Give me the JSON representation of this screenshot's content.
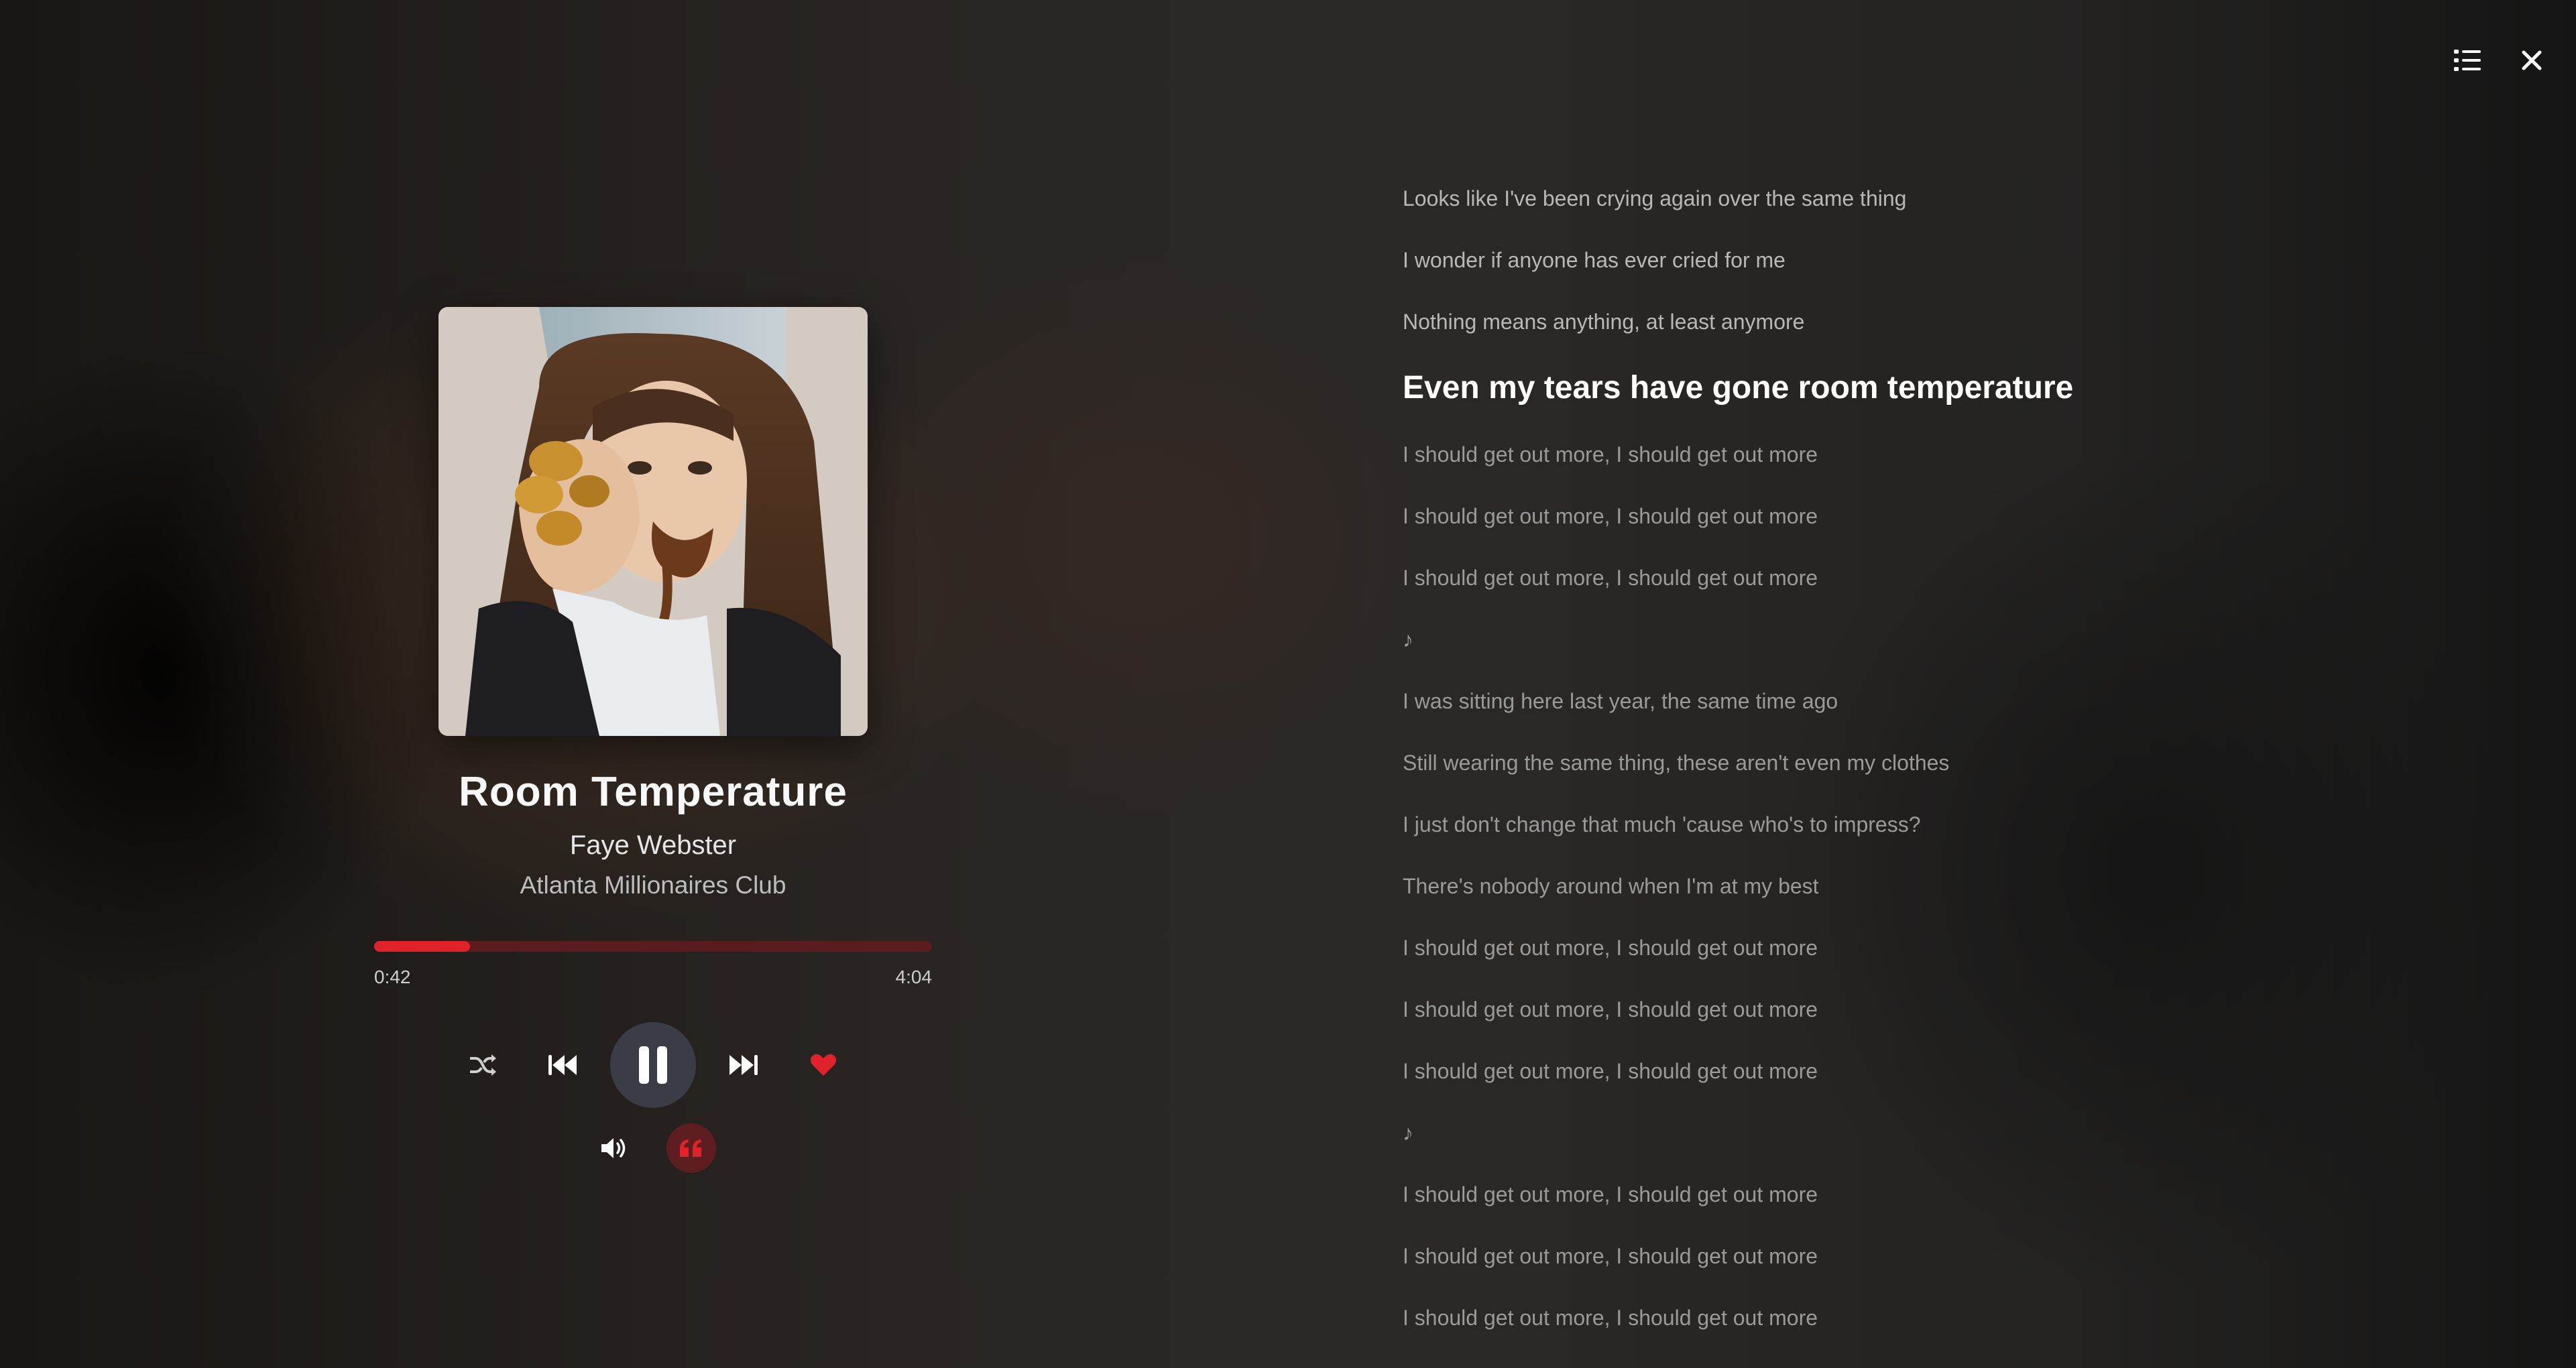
{
  "header": {
    "playlist_icon": "list-icon",
    "close_icon": "close-icon"
  },
  "track": {
    "title": "Room Temperature",
    "artist": "Faye Webster",
    "album": "Atlanta Millionaires Club",
    "elapsed": "0:42",
    "duration": "4:04",
    "progress_fraction": 0.172
  },
  "controls": {
    "shuffle_icon": "shuffle-icon",
    "previous_icon": "rewind-icon",
    "play_pause_icon": "pause-icon",
    "next_icon": "fast-forward-icon",
    "favorite_icon": "heart-icon",
    "volume_icon": "volume-icon",
    "lyrics_icon": "quote-icon"
  },
  "colors": {
    "accent": "#e0222b",
    "track_bg": "#5a1c1e",
    "play_bg": "#3a3d45"
  },
  "lyrics": [
    {
      "text": "Looks like I've been crying again over the same thing",
      "state": "past"
    },
    {
      "text": "I wonder if anyone has ever cried for me",
      "state": "past"
    },
    {
      "text": "Nothing means anything, at least anymore",
      "state": "past"
    },
    {
      "text": "Even my tears have gone room temperature",
      "state": "current"
    },
    {
      "text": "I should get out more, I should get out more",
      "state": "upcoming"
    },
    {
      "text": "I should get out more, I should get out more",
      "state": "upcoming"
    },
    {
      "text": "I should get out more, I should get out more",
      "state": "upcoming"
    },
    {
      "text": "♪",
      "state": "upcoming"
    },
    {
      "text": "I was sitting here last year, the same time ago",
      "state": "upcoming"
    },
    {
      "text": "Still wearing the same thing, these aren't even my clothes",
      "state": "upcoming"
    },
    {
      "text": "I just don't change that much 'cause who's to impress?",
      "state": "upcoming"
    },
    {
      "text": "There's nobody around when I'm at my best",
      "state": "upcoming"
    },
    {
      "text": "I should get out more, I should get out more",
      "state": "upcoming"
    },
    {
      "text": "I should get out more, I should get out more",
      "state": "upcoming"
    },
    {
      "text": "I should get out more, I should get out more",
      "state": "upcoming"
    },
    {
      "text": "♪",
      "state": "upcoming"
    },
    {
      "text": "I should get out more, I should get out more",
      "state": "upcoming"
    },
    {
      "text": "I should get out more, I should get out more",
      "state": "upcoming"
    },
    {
      "text": "I should get out more, I should get out more",
      "state": "upcoming"
    }
  ]
}
